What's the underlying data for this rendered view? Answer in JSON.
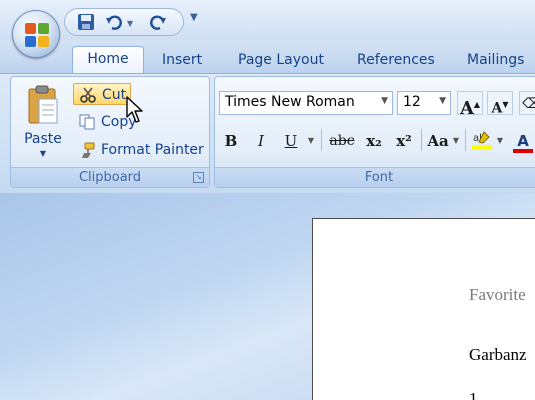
{
  "quick_access": {
    "save_icon": "save-icon",
    "undo_icon": "undo-icon",
    "redo_icon": "redo-icon",
    "customize_icon": "customize-qat-icon"
  },
  "tabs": [
    {
      "label": "Home",
      "active": true
    },
    {
      "label": "Insert"
    },
    {
      "label": "Page Layout"
    },
    {
      "label": "References"
    },
    {
      "label": "Mailings"
    }
  ],
  "clipboard": {
    "paste_label": "Paste",
    "cut_label": "Cut",
    "copy_label": "Copy",
    "format_painter_label": "Format Painter",
    "group_label": "Clipboard"
  },
  "font": {
    "font_name": "Times New Roman",
    "font_size": "12",
    "group_label": "Font",
    "bold": "B",
    "italic": "I",
    "underline": "U",
    "strikethrough": "abc",
    "subscript": "x₂",
    "superscript": "x²",
    "change_case": "Aa",
    "grow_font": "A",
    "shrink_font": "A",
    "font_color": "A"
  },
  "document": {
    "line1": "Favorite",
    "line2": "Garbanz",
    "line3": "1"
  },
  "colors": {
    "accent": "#15428b",
    "highlight_yellow": "#ffff00",
    "font_red": "#e00000"
  }
}
